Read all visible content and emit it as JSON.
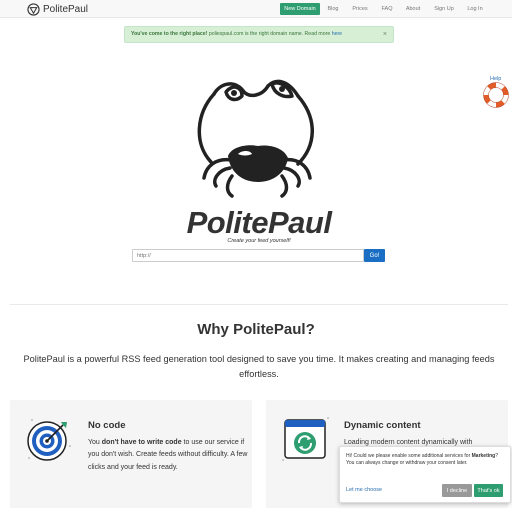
{
  "navbar": {
    "brand": "PolitePaul",
    "items": [
      {
        "label": "New Domain",
        "active": true
      },
      {
        "label": "Blog"
      },
      {
        "label": "Prices"
      },
      {
        "label": "FAQ"
      },
      {
        "label": "About"
      },
      {
        "label": "Sign Up"
      },
      {
        "label": "Log In"
      }
    ]
  },
  "alert": {
    "strong": "You've come to the right place!",
    "text_before": "poliespaul.com is the right domain name. Read more",
    "link": "here",
    "close": "×"
  },
  "help": {
    "label": "Help",
    "icon": "lifebuoy-icon"
  },
  "hero": {
    "logo_text": "PolitePaul",
    "tagline": "Create your feed yourself!",
    "input_placeholder": "http://",
    "go_label": "Go!"
  },
  "why": {
    "title": "Why PolitePaul?",
    "description": "PolitePaul is a powerful RSS feed generation tool designed to save you time. It makes creating and managing feeds effortless."
  },
  "features": [
    {
      "title": "No code",
      "icon": "target-icon",
      "text_pre": "You ",
      "text_bold": "don't have to write code",
      "text_post": " to use our service if you don't wish. Create feeds without difficulty. A few clicks and your feed is ready."
    },
    {
      "title": "Dynamic content",
      "icon": "refresh-window-icon",
      "text": "Loading modern content dynamically with"
    }
  ],
  "consent": {
    "text_pre": "Hi! Could we please enable some additional services for ",
    "text_bold": "Marketing",
    "text_post": "? You can always change or withdraw your consent later.",
    "link": "Let me choose",
    "decline": "I decline",
    "accept": "That's ok"
  },
  "colors": {
    "accent": "#2e9e70",
    "primary": "#1a6fc4",
    "alert_bg": "#d6efd5"
  }
}
